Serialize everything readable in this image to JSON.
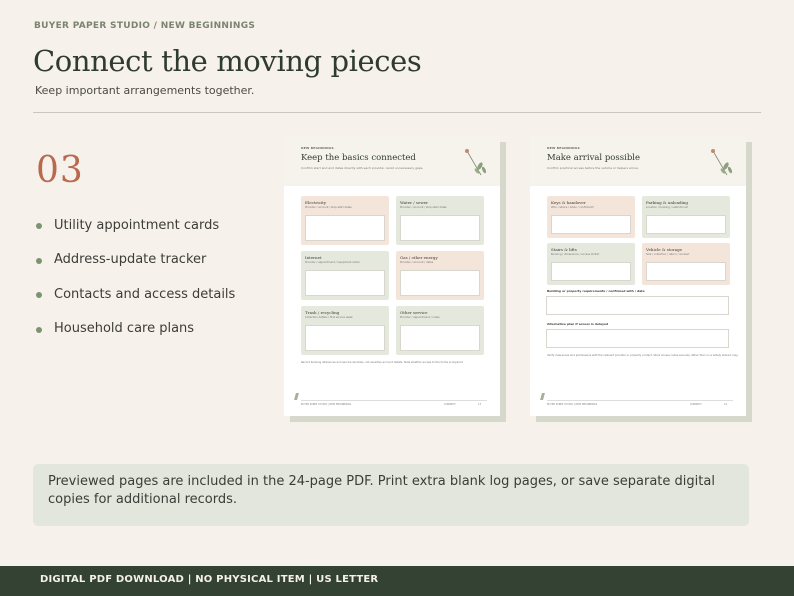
{
  "breadcrumb": "BUYER PAPER STUDIO  /  NEW BEGINNINGS",
  "headline": "Connect the moving pieces",
  "subheadline": "Keep important arrangements together.",
  "section_number": "03",
  "features": [
    "Utility appointment cards",
    "Address-update tracker",
    "Contacts and access details",
    "Household care plans"
  ],
  "page1": {
    "kicker": "NEW BEGINNINGS",
    "title": "Keep the basics connected",
    "subtitle": "Confirm start and end dates directly with each provider. Avoid unnecessary gaps.",
    "cards": [
      {
        "title": "Electricity",
        "sub": "Provider / account / stop-start dates"
      },
      {
        "title": "Water / sewer",
        "sub": "Provider / account / stop-start dates"
      },
      {
        "title": "Internet",
        "sub": "Provider / appointment / equipment return"
      },
      {
        "title": "Gas / other energy",
        "sub": "Provider / account / dates"
      },
      {
        "title": "Trash / recycling",
        "sub": "Collection details / first service week"
      },
      {
        "title": "Other service",
        "sub": "Provider / appointment / notes"
      }
    ],
    "note": "Record booking references and service windows, not sensitive account details. Note whether access to the home is required.",
    "footer_left": "BUYER PAPER STUDIO  |  NEW BEGINNINGS",
    "footer_section": "CONNECT",
    "footer_page": "13"
  },
  "page2": {
    "kicker": "NEW BEGINNINGS",
    "title": "Make arrival possible",
    "subtitle": "Confirm practical access before the vehicle or helpers arrive.",
    "cards": [
      {
        "title": "Keys & handover",
        "sub": "Who / where / when / confirmed?"
      },
      {
        "title": "Parking & unloading",
        "sub": "Location / booking / restrictions?"
      },
      {
        "title": "Stairs & lifts",
        "sub": "Booking / dimensions / access limits?"
      },
      {
        "title": "Vehicle & storage",
        "sub": "Size / collection / return / access?"
      }
    ],
    "field1_label": "Building or property requirements / confirmed with / date",
    "field2_label": "Alternative plan if access is delayed",
    "note": "Verify clearances and permissions with the relevant provider or property contact. Store access codes securely rather than on a widely shared copy.",
    "footer_left": "BUYER PAPER STUDIO  |  NEW BEGINNINGS",
    "footer_section": "CONNECT",
    "footer_page": "14"
  },
  "info_text": "Previewed pages are included in the 24-page PDF. Print extra blank log pages, or save separate digital copies for additional records.",
  "footer_bar": "DIGITAL PDF DOWNLOAD  |  NO PHYSICAL ITEM  |  US LETTER",
  "colors": {
    "background": "#f6f2eb",
    "accent_terracotta": "#b96a4e",
    "forest": "#334233",
    "sage_bullet": "#7a9470",
    "card_sage": "#e5e9dd",
    "card_peach": "#f3e5da"
  }
}
